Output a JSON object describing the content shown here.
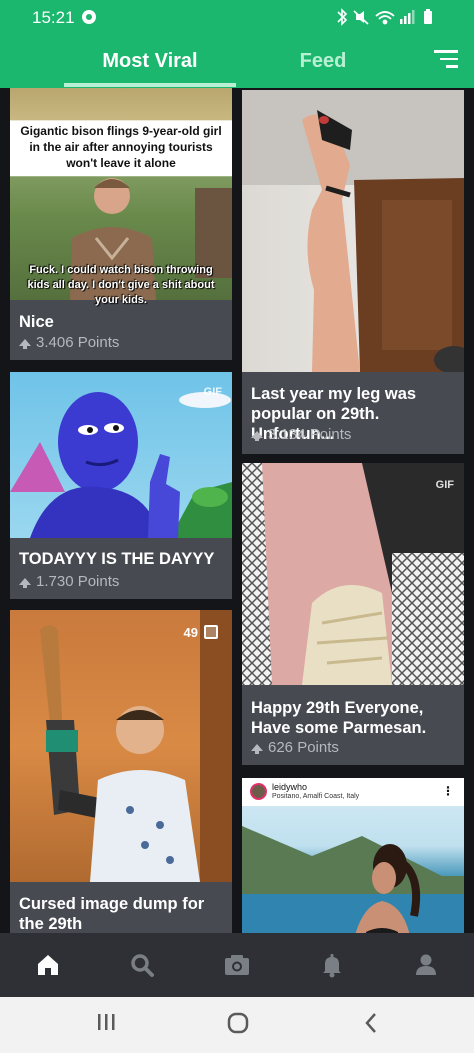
{
  "status_bar": {
    "time": "15:21",
    "icons": [
      "bluetooth-icon",
      "mute-icon",
      "wifi-icon",
      "signal-icon",
      "battery-icon"
    ]
  },
  "app_bar": {
    "tabs": [
      {
        "label": "Most Viral",
        "active": true
      },
      {
        "label": "Feed",
        "active": false
      }
    ],
    "filter_icon": "filter-icon"
  },
  "posts": [
    {
      "title": "Nice",
      "points": "3.406 Points",
      "meme_top_text": "Gigantic bison flings 9-year-old girl in the air after annoying tourists won't leave it alone",
      "meme_bottom_text": "Fuck. I could watch bison throwing kids all day. I don't give a shit about your kids."
    },
    {
      "title": "TODAYYY IS THE DAYYY",
      "points": "1.730 Points",
      "badge": "GIF"
    },
    {
      "title": "Cursed image dump for the 29th",
      "album_count": "49"
    },
    {
      "title": "Last year my leg was popular on 29th. Unfortun...",
      "points": "3.134 Points"
    },
    {
      "title": "Happy 29th Everyone, Have some Parmesan.",
      "points": "626 Points",
      "badge": "GIF"
    },
    {
      "insta_user": "leidywho",
      "insta_location": "Positano, Amalfi Coast, Italy"
    }
  ],
  "bottom_nav": [
    "home-icon",
    "search-icon",
    "camera-icon",
    "notification-bell-icon",
    "profile-icon"
  ],
  "system_nav": [
    "recent-apps-icon",
    "home-circle-icon",
    "back-icon"
  ],
  "colors": {
    "brand_green": "#1bb76e",
    "card_bg": "#474a51",
    "page_bg": "#131518"
  }
}
